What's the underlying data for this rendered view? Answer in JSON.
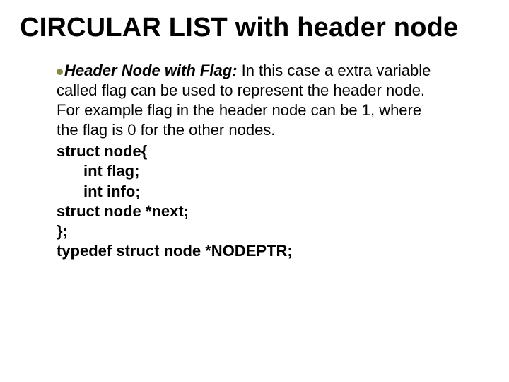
{
  "title": "CIRCULAR LIST with header node",
  "bullet": {
    "term": "Header Node with Flag:",
    "desc": " In this case a extra variable called flag can be used to represent the header node. For example flag in the header node can be 1, where the flag is 0 for the other nodes."
  },
  "code": {
    "l1": "struct node{",
    "l2": "int flag;",
    "l3": "int info;",
    "l4": "struct node *next;",
    "l5": "};",
    "l6": "typedef struct node *NODEPTR;"
  }
}
